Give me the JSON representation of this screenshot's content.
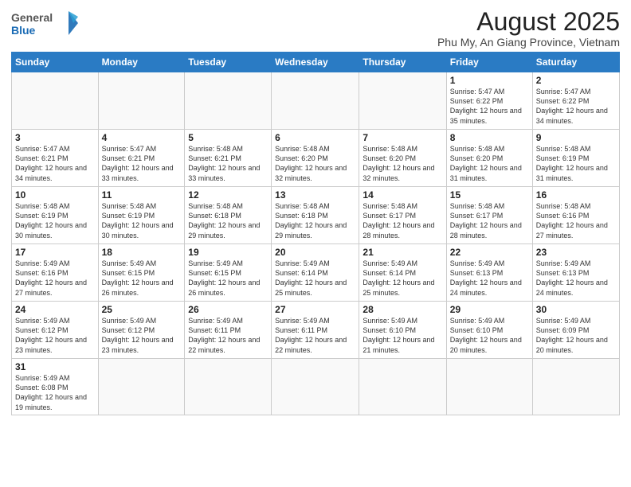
{
  "logo": {
    "text_general": "General",
    "text_blue": "Blue"
  },
  "title": "August 2025",
  "subtitle": "Phu My, An Giang Province, Vietnam",
  "days_of_week": [
    "Sunday",
    "Monday",
    "Tuesday",
    "Wednesday",
    "Thursday",
    "Friday",
    "Saturday"
  ],
  "weeks": [
    [
      {
        "day": "",
        "info": ""
      },
      {
        "day": "",
        "info": ""
      },
      {
        "day": "",
        "info": ""
      },
      {
        "day": "",
        "info": ""
      },
      {
        "day": "",
        "info": ""
      },
      {
        "day": "1",
        "info": "Sunrise: 5:47 AM\nSunset: 6:22 PM\nDaylight: 12 hours and 35 minutes."
      },
      {
        "day": "2",
        "info": "Sunrise: 5:47 AM\nSunset: 6:22 PM\nDaylight: 12 hours and 34 minutes."
      }
    ],
    [
      {
        "day": "3",
        "info": "Sunrise: 5:47 AM\nSunset: 6:21 PM\nDaylight: 12 hours and 34 minutes."
      },
      {
        "day": "4",
        "info": "Sunrise: 5:47 AM\nSunset: 6:21 PM\nDaylight: 12 hours and 33 minutes."
      },
      {
        "day": "5",
        "info": "Sunrise: 5:48 AM\nSunset: 6:21 PM\nDaylight: 12 hours and 33 minutes."
      },
      {
        "day": "6",
        "info": "Sunrise: 5:48 AM\nSunset: 6:20 PM\nDaylight: 12 hours and 32 minutes."
      },
      {
        "day": "7",
        "info": "Sunrise: 5:48 AM\nSunset: 6:20 PM\nDaylight: 12 hours and 32 minutes."
      },
      {
        "day": "8",
        "info": "Sunrise: 5:48 AM\nSunset: 6:20 PM\nDaylight: 12 hours and 31 minutes."
      },
      {
        "day": "9",
        "info": "Sunrise: 5:48 AM\nSunset: 6:19 PM\nDaylight: 12 hours and 31 minutes."
      }
    ],
    [
      {
        "day": "10",
        "info": "Sunrise: 5:48 AM\nSunset: 6:19 PM\nDaylight: 12 hours and 30 minutes."
      },
      {
        "day": "11",
        "info": "Sunrise: 5:48 AM\nSunset: 6:19 PM\nDaylight: 12 hours and 30 minutes."
      },
      {
        "day": "12",
        "info": "Sunrise: 5:48 AM\nSunset: 6:18 PM\nDaylight: 12 hours and 29 minutes."
      },
      {
        "day": "13",
        "info": "Sunrise: 5:48 AM\nSunset: 6:18 PM\nDaylight: 12 hours and 29 minutes."
      },
      {
        "day": "14",
        "info": "Sunrise: 5:48 AM\nSunset: 6:17 PM\nDaylight: 12 hours and 28 minutes."
      },
      {
        "day": "15",
        "info": "Sunrise: 5:48 AM\nSunset: 6:17 PM\nDaylight: 12 hours and 28 minutes."
      },
      {
        "day": "16",
        "info": "Sunrise: 5:48 AM\nSunset: 6:16 PM\nDaylight: 12 hours and 27 minutes."
      }
    ],
    [
      {
        "day": "17",
        "info": "Sunrise: 5:49 AM\nSunset: 6:16 PM\nDaylight: 12 hours and 27 minutes."
      },
      {
        "day": "18",
        "info": "Sunrise: 5:49 AM\nSunset: 6:15 PM\nDaylight: 12 hours and 26 minutes."
      },
      {
        "day": "19",
        "info": "Sunrise: 5:49 AM\nSunset: 6:15 PM\nDaylight: 12 hours and 26 minutes."
      },
      {
        "day": "20",
        "info": "Sunrise: 5:49 AM\nSunset: 6:14 PM\nDaylight: 12 hours and 25 minutes."
      },
      {
        "day": "21",
        "info": "Sunrise: 5:49 AM\nSunset: 6:14 PM\nDaylight: 12 hours and 25 minutes."
      },
      {
        "day": "22",
        "info": "Sunrise: 5:49 AM\nSunset: 6:13 PM\nDaylight: 12 hours and 24 minutes."
      },
      {
        "day": "23",
        "info": "Sunrise: 5:49 AM\nSunset: 6:13 PM\nDaylight: 12 hours and 24 minutes."
      }
    ],
    [
      {
        "day": "24",
        "info": "Sunrise: 5:49 AM\nSunset: 6:12 PM\nDaylight: 12 hours and 23 minutes."
      },
      {
        "day": "25",
        "info": "Sunrise: 5:49 AM\nSunset: 6:12 PM\nDaylight: 12 hours and 23 minutes."
      },
      {
        "day": "26",
        "info": "Sunrise: 5:49 AM\nSunset: 6:11 PM\nDaylight: 12 hours and 22 minutes."
      },
      {
        "day": "27",
        "info": "Sunrise: 5:49 AM\nSunset: 6:11 PM\nDaylight: 12 hours and 22 minutes."
      },
      {
        "day": "28",
        "info": "Sunrise: 5:49 AM\nSunset: 6:10 PM\nDaylight: 12 hours and 21 minutes."
      },
      {
        "day": "29",
        "info": "Sunrise: 5:49 AM\nSunset: 6:10 PM\nDaylight: 12 hours and 20 minutes."
      },
      {
        "day": "30",
        "info": "Sunrise: 5:49 AM\nSunset: 6:09 PM\nDaylight: 12 hours and 20 minutes."
      }
    ],
    [
      {
        "day": "31",
        "info": "Sunrise: 5:49 AM\nSunset: 6:08 PM\nDaylight: 12 hours and 19 minutes."
      },
      {
        "day": "",
        "info": ""
      },
      {
        "day": "",
        "info": ""
      },
      {
        "day": "",
        "info": ""
      },
      {
        "day": "",
        "info": ""
      },
      {
        "day": "",
        "info": ""
      },
      {
        "day": "",
        "info": ""
      }
    ]
  ]
}
